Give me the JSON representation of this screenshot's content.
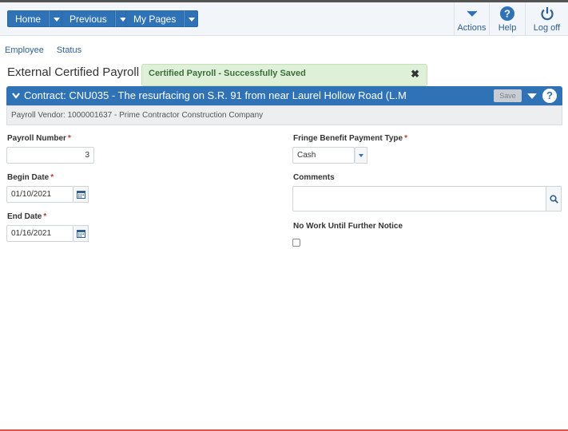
{
  "toolbar": {
    "home_label": "Home",
    "previous_label": "Previous",
    "my_pages_label": "My Pages",
    "actions_label": "Actions",
    "help_label": "Help",
    "logoff_label": "Log off"
  },
  "subnav": {
    "employee": "Employee",
    "status": "Status"
  },
  "page": {
    "title": "External Certified Payroll"
  },
  "toast": {
    "message": "Certified Payroll - Successfully Saved",
    "close": "✖"
  },
  "contract": {
    "title": "Contract: CNU035 - The resurfacing on S.R. 91 from near Laurel Hollow Road (L.M",
    "save_label": "Save",
    "help": "?",
    "vendor": "Payroll Vendor: 1000001637 - Prime Contractor Construction Company"
  },
  "form": {
    "payroll_number_label": "Payroll Number",
    "payroll_number_value": "3",
    "begin_date_label": "Begin Date",
    "begin_date_value": "01/10/2021",
    "end_date_label": "End Date",
    "end_date_value": "01/16/2021",
    "fringe_label": "Fringe Benefit Payment Type",
    "fringe_value": "Cash",
    "comments_label": "Comments",
    "comments_value": "",
    "no_work_label": "No Work Until Further Notice",
    "no_work_checked": false,
    "required_marker": "*"
  },
  "colors": {
    "primary": "#2f72b6",
    "success_bg": "#dff0d8",
    "required": "#c0392b"
  }
}
